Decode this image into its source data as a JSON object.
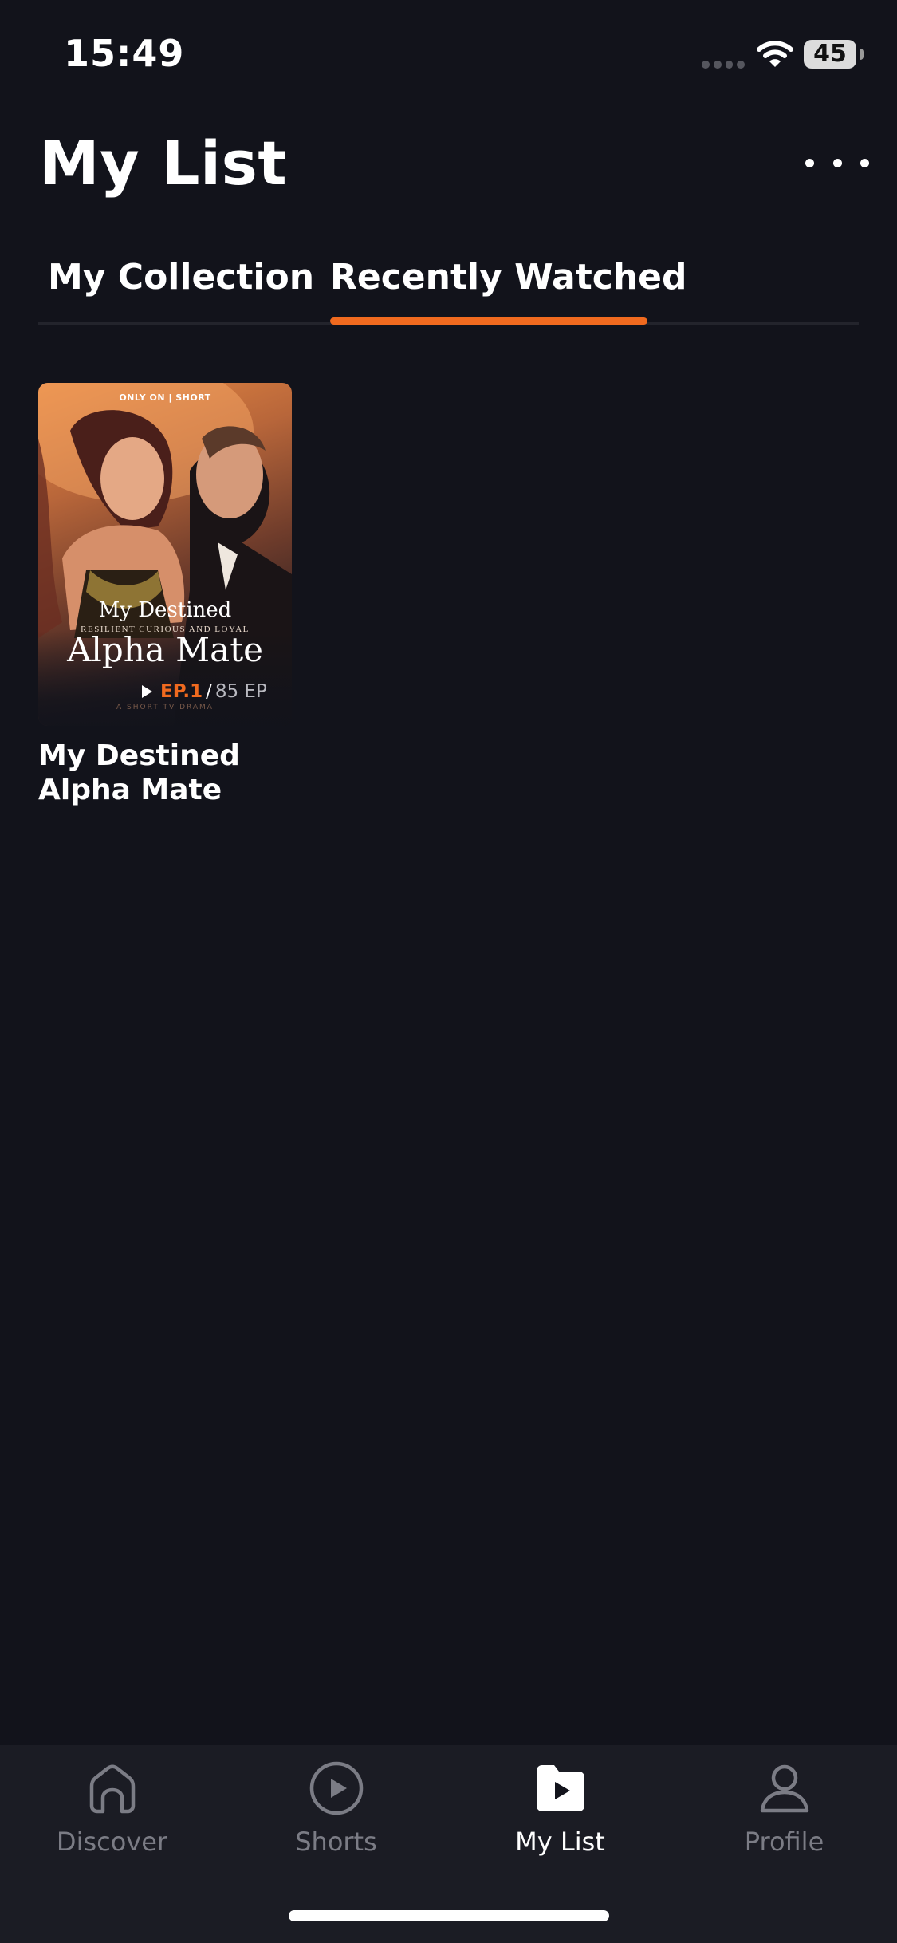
{
  "status_bar": {
    "time": "15:49",
    "battery": "45"
  },
  "header": {
    "title": "My List",
    "more_icon": "more-horizontal-icon"
  },
  "tabs": [
    {
      "label": "My Collection",
      "active": false
    },
    {
      "label": "Recently Watched",
      "active": true
    }
  ],
  "accent_color": "#f06a1f",
  "items": [
    {
      "title": "My Destined Alpha Mate",
      "poster": {
        "badge": "ONLY ON | SHORT",
        "title_top": "My Destined",
        "tagline": "RESILIENT CURIOUS AND LOYAL",
        "title_main": "Alpha Mate",
        "subtag": "A SHORT TV DRAMA"
      },
      "episode_current": "EP.1",
      "episode_separator": "/",
      "episode_total": "85 EP"
    }
  ],
  "bottom_nav": [
    {
      "label": "Discover",
      "icon": "home-icon",
      "active": false
    },
    {
      "label": "Shorts",
      "icon": "play-circle-icon",
      "active": false
    },
    {
      "label": "My List",
      "icon": "folder-play-icon",
      "active": true
    },
    {
      "label": "Profile",
      "icon": "person-icon",
      "active": false
    }
  ]
}
